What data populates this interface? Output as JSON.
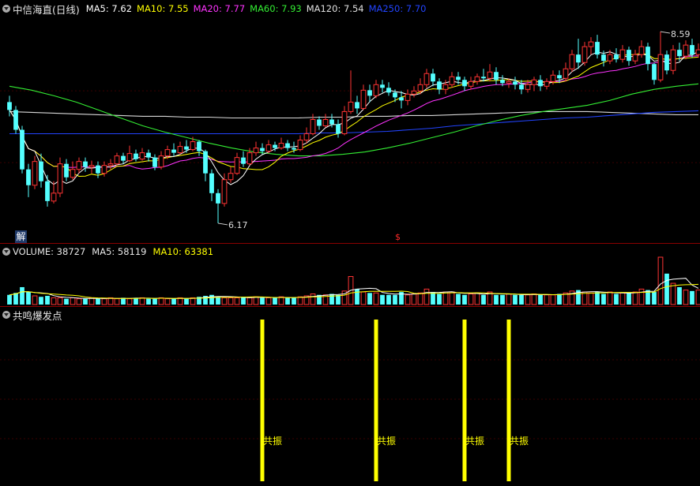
{
  "price_header": {
    "title": "中信海直(日线)",
    "ma_items": [
      {
        "text": "MA5: 7.62",
        "color": "#ffffff"
      },
      {
        "text": "MA10: 7.55",
        "color": "#ffff00"
      },
      {
        "text": "MA20: 7.77",
        "color": "#ff33ff"
      },
      {
        "text": "MA60: 7.93",
        "color": "#33ee33"
      },
      {
        "text": "MA120: 7.54",
        "color": "#e0e0e0"
      },
      {
        "text": "MA250: 7.70",
        "color": "#2244ff"
      }
    ]
  },
  "volume_header": {
    "items": [
      {
        "text": "VOLUME: 38727",
        "color": "#e6e6e6"
      },
      {
        "text": "MA5: 58119",
        "color": "#e6e6e6"
      },
      {
        "text": "MA10: 63381",
        "color": "#ffff00"
      }
    ]
  },
  "indicator_header": {
    "title": "共鸣爆发点"
  },
  "annotations": {
    "high_label": "8.59",
    "low_label": "6.17",
    "jie_badge": "解",
    "dollar_mark": "$"
  },
  "signal_label": "共振",
  "colors": {
    "up": "#ff3333",
    "down": "#54ffff",
    "separator": "#8a0000",
    "signal": "#ffff00"
  },
  "chart_data": {
    "type": "candlestick",
    "price_min": 6.0,
    "price_max": 8.75,
    "candles": [
      [
        7.7,
        7.6,
        7.78,
        7.52
      ],
      [
        7.6,
        7.35,
        7.65,
        7.3
      ],
      [
        7.35,
        6.85,
        7.4,
        6.8
      ],
      [
        6.85,
        6.65,
        6.92,
        6.5
      ],
      [
        6.65,
        6.95,
        7.02,
        6.6
      ],
      [
        6.95,
        6.7,
        7.05,
        6.62
      ],
      [
        6.7,
        6.45,
        6.78,
        6.38
      ],
      [
        6.45,
        6.55,
        6.7,
        6.42
      ],
      [
        6.55,
        6.92,
        7.0,
        6.5
      ],
      [
        6.92,
        6.75,
        6.98,
        6.7
      ],
      [
        6.75,
        6.85,
        6.95,
        6.72
      ],
      [
        6.85,
        6.95,
        7.0,
        6.8
      ],
      [
        6.95,
        6.88,
        7.0,
        6.82
      ],
      [
        6.88,
        6.9,
        6.96,
        6.8
      ],
      [
        6.9,
        6.8,
        6.95,
        6.74
      ],
      [
        6.8,
        6.9,
        6.95,
        6.76
      ],
      [
        6.9,
        6.92,
        6.98,
        6.85
      ],
      [
        6.92,
        7.02,
        7.06,
        6.9
      ],
      [
        7.02,
        6.96,
        7.06,
        6.92
      ],
      [
        6.96,
        7.05,
        7.15,
        6.94
      ],
      [
        7.05,
        6.98,
        7.1,
        6.95
      ],
      [
        6.98,
        7.06,
        7.12,
        6.96
      ],
      [
        7.06,
        7.0,
        7.1,
        6.95
      ],
      [
        7.0,
        6.88,
        7.04,
        6.84
      ],
      [
        6.88,
        7.02,
        7.08,
        6.85
      ],
      [
        7.02,
        7.1,
        7.15,
        6.98
      ],
      [
        7.1,
        7.06,
        7.18,
        7.02
      ],
      [
        7.06,
        7.14,
        7.2,
        7.04
      ],
      [
        7.14,
        7.1,
        7.22,
        7.06
      ],
      [
        7.1,
        7.2,
        7.26,
        7.08
      ],
      [
        7.2,
        7.08,
        7.22,
        7.02
      ],
      [
        7.08,
        6.8,
        7.1,
        6.7
      ],
      [
        6.8,
        6.55,
        6.85,
        6.45
      ],
      [
        6.55,
        6.42,
        6.6,
        6.17
      ],
      [
        6.42,
        6.72,
        6.8,
        6.38
      ],
      [
        6.72,
        6.8,
        6.88,
        6.68
      ],
      [
        6.8,
        7.0,
        7.06,
        6.78
      ],
      [
        7.0,
        6.92,
        7.08,
        6.88
      ],
      [
        6.92,
        7.06,
        7.12,
        6.9
      ],
      [
        7.06,
        7.12,
        7.2,
        7.02
      ],
      [
        7.12,
        7.08,
        7.18,
        7.04
      ],
      [
        7.08,
        7.16,
        7.22,
        7.05
      ],
      [
        7.16,
        7.12,
        7.2,
        7.08
      ],
      [
        7.12,
        7.18,
        7.25,
        7.1
      ],
      [
        7.18,
        7.12,
        7.22,
        7.08
      ],
      [
        7.12,
        7.1,
        7.2,
        7.06
      ],
      [
        7.1,
        7.22,
        7.28,
        7.08
      ],
      [
        7.22,
        7.3,
        7.38,
        7.18
      ],
      [
        7.3,
        7.48,
        7.55,
        7.28
      ],
      [
        7.48,
        7.4,
        7.52,
        7.35
      ],
      [
        7.4,
        7.48,
        7.55,
        7.38
      ],
      [
        7.48,
        7.42,
        7.55,
        7.38
      ],
      [
        7.42,
        7.3,
        7.48,
        7.25
      ],
      [
        7.3,
        7.58,
        7.65,
        7.28
      ],
      [
        7.58,
        7.7,
        8.1,
        7.55
      ],
      [
        7.7,
        7.62,
        7.78,
        7.55
      ],
      [
        7.62,
        7.85,
        7.92,
        7.6
      ],
      [
        7.85,
        7.78,
        7.92,
        7.7
      ],
      [
        7.78,
        7.92,
        7.98,
        7.75
      ],
      [
        7.92,
        7.88,
        7.98,
        7.82
      ],
      [
        7.88,
        7.82,
        7.95,
        7.78
      ],
      [
        7.82,
        7.76,
        7.86,
        7.7
      ],
      [
        7.76,
        7.72,
        7.84,
        7.62
      ],
      [
        7.72,
        7.8,
        7.86,
        7.66
      ],
      [
        7.8,
        7.84,
        7.9,
        7.76
      ],
      [
        7.84,
        7.92,
        8.0,
        7.8
      ],
      [
        7.92,
        8.06,
        8.12,
        7.88
      ],
      [
        8.06,
        7.96,
        8.12,
        7.9
      ],
      [
        7.96,
        7.86,
        8.0,
        7.8
      ],
      [
        7.86,
        7.92,
        7.98,
        7.8
      ],
      [
        7.92,
        8.02,
        8.08,
        7.88
      ],
      [
        8.02,
        7.98,
        8.08,
        7.92
      ],
      [
        7.98,
        7.9,
        8.02,
        7.84
      ],
      [
        7.9,
        7.96,
        8.02,
        7.86
      ],
      [
        7.96,
        8.02,
        8.06,
        7.92
      ],
      [
        8.02,
        8.0,
        8.12,
        7.96
      ],
      [
        8.0,
        8.08,
        8.18,
        7.96
      ],
      [
        8.08,
        7.98,
        8.14,
        7.92
      ],
      [
        7.98,
        7.94,
        8.04,
        7.9
      ],
      [
        7.94,
        7.96,
        8.0,
        7.88
      ],
      [
        7.96,
        7.92,
        8.02,
        7.86
      ],
      [
        7.92,
        7.86,
        7.98,
        7.8
      ],
      [
        7.86,
        7.92,
        7.98,
        7.82
      ],
      [
        7.92,
        7.98,
        8.02,
        7.84
      ],
      [
        7.98,
        7.9,
        8.04,
        7.84
      ],
      [
        7.9,
        7.96,
        8.0,
        7.86
      ],
      [
        7.96,
        8.04,
        8.1,
        7.92
      ],
      [
        8.04,
        8.0,
        8.1,
        7.94
      ],
      [
        8.0,
        8.12,
        8.2,
        7.96
      ],
      [
        8.12,
        8.3,
        8.36,
        8.08
      ],
      [
        8.3,
        8.2,
        8.5,
        8.12
      ],
      [
        8.2,
        8.4,
        8.46,
        8.16
      ],
      [
        8.4,
        8.46,
        8.52,
        8.3
      ],
      [
        8.46,
        8.3,
        8.55,
        8.25
      ],
      [
        8.3,
        8.22,
        8.35,
        8.15
      ],
      [
        8.22,
        8.3,
        8.36,
        8.18
      ],
      [
        8.3,
        8.24,
        8.38,
        8.2
      ],
      [
        8.24,
        8.36,
        8.42,
        8.2
      ],
      [
        8.36,
        8.22,
        8.4,
        8.16
      ],
      [
        8.22,
        8.3,
        8.36,
        8.18
      ],
      [
        8.3,
        8.4,
        8.48,
        8.26
      ],
      [
        8.4,
        8.18,
        8.45,
        8.1
      ],
      [
        8.18,
        7.98,
        8.2,
        7.92
      ],
      [
        7.98,
        8.3,
        8.59,
        7.95
      ],
      [
        8.3,
        8.1,
        8.35,
        8.05
      ],
      [
        8.1,
        8.36,
        8.42,
        8.05
      ],
      [
        8.36,
        8.28,
        8.45,
        8.22
      ],
      [
        8.28,
        8.42,
        8.48,
        8.24
      ],
      [
        8.42,
        8.3,
        8.5,
        8.26
      ],
      [
        8.3,
        8.36,
        8.44,
        8.26
      ]
    ],
    "volumes": [
      1.0,
      1.2,
      1.8,
      1.3,
      0.9,
      0.8,
      0.9,
      0.7,
      0.7,
      0.6,
      0.7,
      0.6,
      0.6,
      0.7,
      0.6,
      0.6,
      0.7,
      0.6,
      0.7,
      0.6,
      0.7,
      0.7,
      0.6,
      0.6,
      0.7,
      0.6,
      0.6,
      0.7,
      0.6,
      0.7,
      0.8,
      0.9,
      1.0,
      0.8,
      0.7,
      0.7,
      0.7,
      0.8,
      0.7,
      0.8,
      0.7,
      0.7,
      0.7,
      0.8,
      0.7,
      0.7,
      0.8,
      0.9,
      1.1,
      1.0,
      1.0,
      1.1,
      1.0,
      1.4,
      2.9,
      1.6,
      1.3,
      1.2,
      1.2,
      1.0,
      1.0,
      1.0,
      1.3,
      1.0,
      1.1,
      1.2,
      1.6,
      1.3,
      1.1,
      1.3,
      1.3,
      1.1,
      1.0,
      1.1,
      1.2,
      1.0,
      1.3,
      1.0,
      1.0,
      1.1,
      1.0,
      1.0,
      1.0,
      1.1,
      1.0,
      1.0,
      1.0,
      1.1,
      1.2,
      1.4,
      1.5,
      1.3,
      1.2,
      1.3,
      1.1,
      1.3,
      1.1,
      1.2,
      1.2,
      1.3,
      1.6,
      1.5,
      1.3,
      4.9,
      3.2,
      2.2,
      1.8,
      1.5,
      1.4,
      1.5
    ],
    "ma120_line": [
      7.58,
      7.57,
      7.56,
      7.55,
      7.54,
      7.53,
      7.52,
      7.52,
      7.51,
      7.51,
      7.5,
      7.5,
      7.5,
      7.5,
      7.51,
      7.51,
      7.52,
      7.52,
      7.53,
      7.53,
      7.54,
      7.55,
      7.56,
      7.57,
      7.58,
      7.58,
      7.58,
      7.57,
      7.56,
      7.55,
      7.54,
      7.54
    ],
    "ma250_line": [
      7.3,
      7.3,
      7.3,
      7.3,
      7.3,
      7.3,
      7.3,
      7.3,
      7.3,
      7.3,
      7.3,
      7.3,
      7.3,
      7.3,
      7.31,
      7.31,
      7.32,
      7.33,
      7.35,
      7.37,
      7.4,
      7.42,
      7.44,
      7.46,
      7.48,
      7.5,
      7.51,
      7.53,
      7.55,
      7.57,
      7.58,
      7.59
    ],
    "ma60_line": [
      7.9,
      7.85,
      7.78,
      7.7,
      7.6,
      7.5,
      7.4,
      7.32,
      7.25,
      7.18,
      7.12,
      7.07,
      7.04,
      7.02,
      7.02,
      7.04,
      7.07,
      7.12,
      7.18,
      7.25,
      7.32,
      7.4,
      7.47,
      7.53,
      7.58,
      7.62,
      7.66,
      7.72,
      7.8,
      7.86,
      7.9,
      7.93
    ],
    "signal_indices": [
      40,
      58,
      72,
      79
    ]
  }
}
